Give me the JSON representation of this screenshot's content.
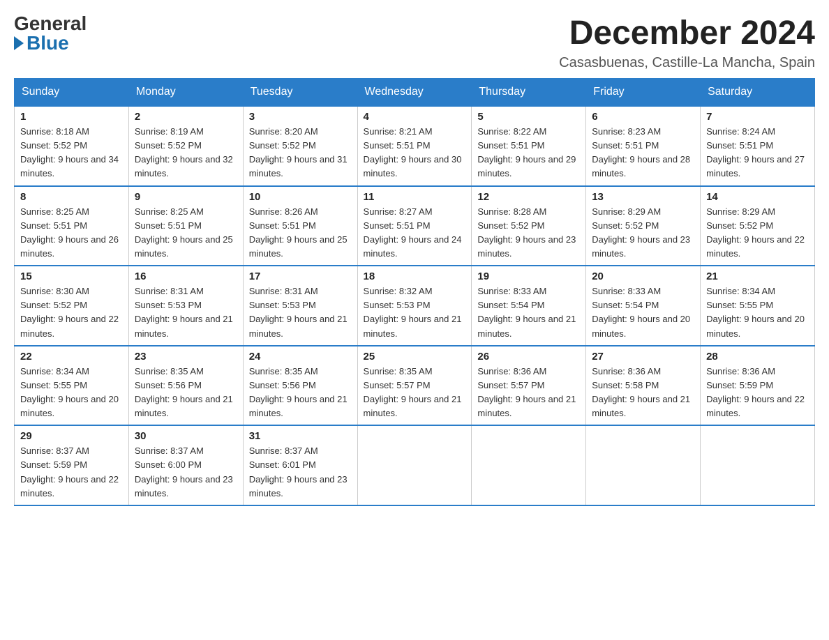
{
  "logo": {
    "general": "General",
    "blue": "Blue"
  },
  "title": "December 2024",
  "location": "Casasbuenas, Castille-La Mancha, Spain",
  "weekdays": [
    "Sunday",
    "Monday",
    "Tuesday",
    "Wednesday",
    "Thursday",
    "Friday",
    "Saturday"
  ],
  "weeks": [
    [
      {
        "day": "1",
        "sunrise": "8:18 AM",
        "sunset": "5:52 PM",
        "daylight": "9 hours and 34 minutes."
      },
      {
        "day": "2",
        "sunrise": "8:19 AM",
        "sunset": "5:52 PM",
        "daylight": "9 hours and 32 minutes."
      },
      {
        "day": "3",
        "sunrise": "8:20 AM",
        "sunset": "5:52 PM",
        "daylight": "9 hours and 31 minutes."
      },
      {
        "day": "4",
        "sunrise": "8:21 AM",
        "sunset": "5:51 PM",
        "daylight": "9 hours and 30 minutes."
      },
      {
        "day": "5",
        "sunrise": "8:22 AM",
        "sunset": "5:51 PM",
        "daylight": "9 hours and 29 minutes."
      },
      {
        "day": "6",
        "sunrise": "8:23 AM",
        "sunset": "5:51 PM",
        "daylight": "9 hours and 28 minutes."
      },
      {
        "day": "7",
        "sunrise": "8:24 AM",
        "sunset": "5:51 PM",
        "daylight": "9 hours and 27 minutes."
      }
    ],
    [
      {
        "day": "8",
        "sunrise": "8:25 AM",
        "sunset": "5:51 PM",
        "daylight": "9 hours and 26 minutes."
      },
      {
        "day": "9",
        "sunrise": "8:25 AM",
        "sunset": "5:51 PM",
        "daylight": "9 hours and 25 minutes."
      },
      {
        "day": "10",
        "sunrise": "8:26 AM",
        "sunset": "5:51 PM",
        "daylight": "9 hours and 25 minutes."
      },
      {
        "day": "11",
        "sunrise": "8:27 AM",
        "sunset": "5:51 PM",
        "daylight": "9 hours and 24 minutes."
      },
      {
        "day": "12",
        "sunrise": "8:28 AM",
        "sunset": "5:52 PM",
        "daylight": "9 hours and 23 minutes."
      },
      {
        "day": "13",
        "sunrise": "8:29 AM",
        "sunset": "5:52 PM",
        "daylight": "9 hours and 23 minutes."
      },
      {
        "day": "14",
        "sunrise": "8:29 AM",
        "sunset": "5:52 PM",
        "daylight": "9 hours and 22 minutes."
      }
    ],
    [
      {
        "day": "15",
        "sunrise": "8:30 AM",
        "sunset": "5:52 PM",
        "daylight": "9 hours and 22 minutes."
      },
      {
        "day": "16",
        "sunrise": "8:31 AM",
        "sunset": "5:53 PM",
        "daylight": "9 hours and 21 minutes."
      },
      {
        "day": "17",
        "sunrise": "8:31 AM",
        "sunset": "5:53 PM",
        "daylight": "9 hours and 21 minutes."
      },
      {
        "day": "18",
        "sunrise": "8:32 AM",
        "sunset": "5:53 PM",
        "daylight": "9 hours and 21 minutes."
      },
      {
        "day": "19",
        "sunrise": "8:33 AM",
        "sunset": "5:54 PM",
        "daylight": "9 hours and 21 minutes."
      },
      {
        "day": "20",
        "sunrise": "8:33 AM",
        "sunset": "5:54 PM",
        "daylight": "9 hours and 20 minutes."
      },
      {
        "day": "21",
        "sunrise": "8:34 AM",
        "sunset": "5:55 PM",
        "daylight": "9 hours and 20 minutes."
      }
    ],
    [
      {
        "day": "22",
        "sunrise": "8:34 AM",
        "sunset": "5:55 PM",
        "daylight": "9 hours and 20 minutes."
      },
      {
        "day": "23",
        "sunrise": "8:35 AM",
        "sunset": "5:56 PM",
        "daylight": "9 hours and 21 minutes."
      },
      {
        "day": "24",
        "sunrise": "8:35 AM",
        "sunset": "5:56 PM",
        "daylight": "9 hours and 21 minutes."
      },
      {
        "day": "25",
        "sunrise": "8:35 AM",
        "sunset": "5:57 PM",
        "daylight": "9 hours and 21 minutes."
      },
      {
        "day": "26",
        "sunrise": "8:36 AM",
        "sunset": "5:57 PM",
        "daylight": "9 hours and 21 minutes."
      },
      {
        "day": "27",
        "sunrise": "8:36 AM",
        "sunset": "5:58 PM",
        "daylight": "9 hours and 21 minutes."
      },
      {
        "day": "28",
        "sunrise": "8:36 AM",
        "sunset": "5:59 PM",
        "daylight": "9 hours and 22 minutes."
      }
    ],
    [
      {
        "day": "29",
        "sunrise": "8:37 AM",
        "sunset": "5:59 PM",
        "daylight": "9 hours and 22 minutes."
      },
      {
        "day": "30",
        "sunrise": "8:37 AM",
        "sunset": "6:00 PM",
        "daylight": "9 hours and 23 minutes."
      },
      {
        "day": "31",
        "sunrise": "8:37 AM",
        "sunset": "6:01 PM",
        "daylight": "9 hours and 23 minutes."
      },
      null,
      null,
      null,
      null
    ]
  ]
}
